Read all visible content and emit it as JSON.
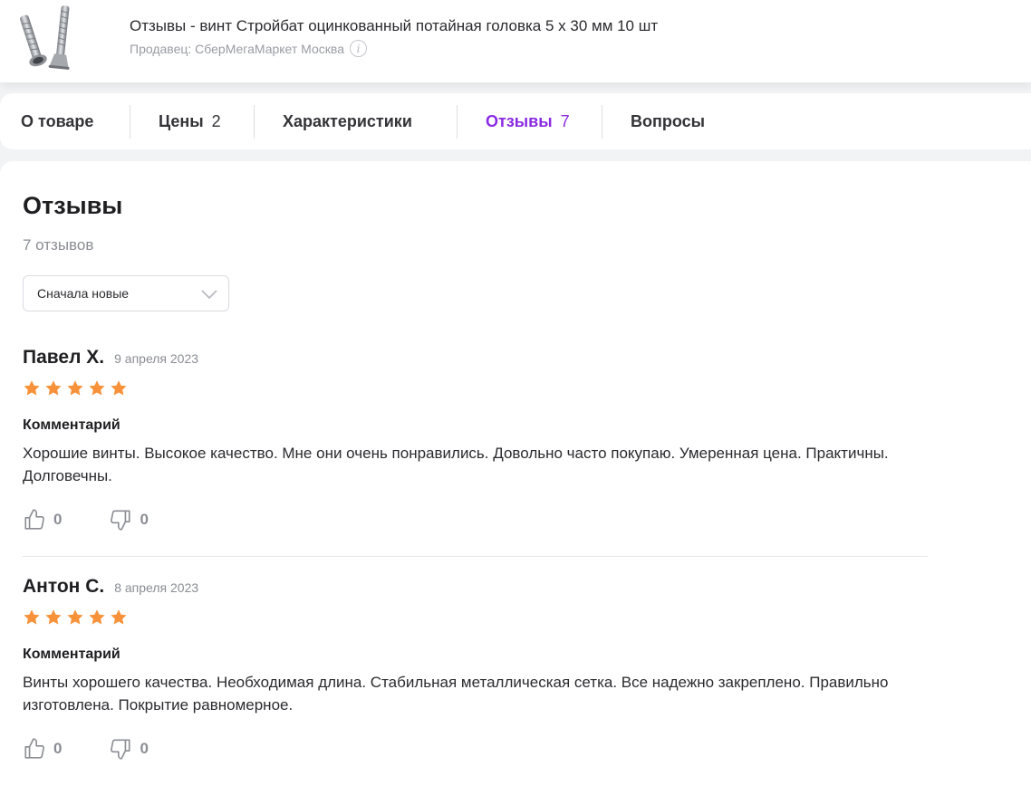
{
  "product": {
    "title": "Отзывы - винт Стройбат оцинкованный потайная головка 5 х 30 мм 10 шт",
    "seller": "Продавец: СберМегаМаркет Москва",
    "info_icon": "info-icon"
  },
  "tabs": [
    {
      "label": "О товаре",
      "count": ""
    },
    {
      "label": "Цены",
      "count": "2"
    },
    {
      "label": "Характеристики",
      "count": ""
    },
    {
      "label": "Отзывы",
      "count": "7",
      "active": true
    },
    {
      "label": "Вопросы",
      "count": ""
    }
  ],
  "reviews_section": {
    "heading": "Отзывы",
    "count_text": "7 отзывов",
    "sort": {
      "selected": "Сначала новые",
      "icon": "chevron-down-icon"
    }
  },
  "reviews": [
    {
      "author": "Павел Х.",
      "date": "9 апреля 2023",
      "rating": 5,
      "comment_label": "Комментарий",
      "comment": "Хорошие винты. Высокое качество. Мне они очень понравились. Довольно часто покупаю. Умеренная цена. Практичны. Долговечны.",
      "likes": "0",
      "dislikes": "0"
    },
    {
      "author": "Антон С.",
      "date": "8 апреля 2023",
      "rating": 5,
      "comment_label": "Комментарий",
      "comment": "Винты хорошего качества. Необходимая длина. Стабильная металлическая сетка. Все надежно закреплено. Правильно изготовлена. Покрытие равномерное.",
      "likes": "0",
      "dislikes": "0"
    }
  ],
  "colors": {
    "accent": "#8a2be2",
    "star": "#f7923a",
    "muted_text": "#8b8d94"
  }
}
